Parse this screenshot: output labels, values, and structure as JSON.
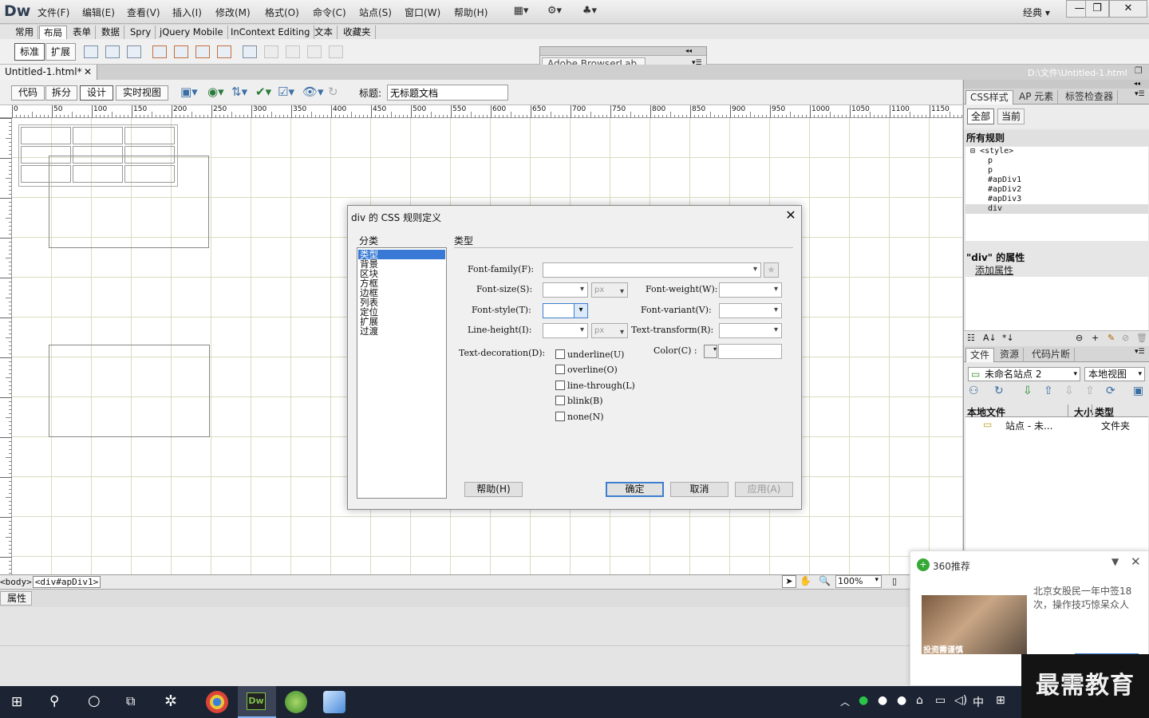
{
  "app": {
    "logo": "Dw",
    "workspace": "经典"
  },
  "menu": [
    "文件(F)",
    "编辑(E)",
    "查看(V)",
    "插入(I)",
    "修改(M)",
    "格式(O)",
    "命令(C)",
    "站点(S)",
    "窗口(W)",
    "帮助(H)"
  ],
  "insert_tabs": [
    "常用",
    "布局",
    "表单",
    "数据",
    "Spry",
    "jQuery Mobile",
    "InContext Editing",
    "文本",
    "收藏夹"
  ],
  "layout_buttons": {
    "standard": "标准",
    "expanded": "扩展"
  },
  "browserlab": {
    "title": "Adobe BrowserLab"
  },
  "document": {
    "tab": "Untitled-1.html*",
    "path": "D:\\文件\\Untitled-1.html"
  },
  "view_buttons": {
    "code": "代码",
    "split": "拆分",
    "design": "设计",
    "live": "实时视图"
  },
  "title_field": {
    "label": "标题:",
    "value": "无标题文档"
  },
  "ruler_marks": [
    "0",
    "50",
    "100",
    "150",
    "200",
    "250",
    "300",
    "350",
    "400",
    "450",
    "500",
    "550",
    "600",
    "650",
    "700",
    "750",
    "800",
    "850",
    "900",
    "950",
    "1000",
    "1050",
    "1100",
    "1150"
  ],
  "status": {
    "tag_body": "<body>",
    "tag_div": "<div#apDiv1>",
    "zoom": "100%"
  },
  "properties": {
    "tab": "属性"
  },
  "css_panel": {
    "tabs": [
      "CSS样式",
      "AP 元素",
      "标签检查器"
    ],
    "mode_all": "全部",
    "mode_current": "当前",
    "all_rules": "所有规则",
    "rules": [
      "<style>",
      "p",
      "p",
      "#apDiv1",
      "#apDiv2",
      "#apDiv3",
      "div"
    ],
    "props_title": "\"div\" 的属性",
    "add_property": "添加属性"
  },
  "files_panel": {
    "tabs": [
      "文件",
      "资源",
      "代码片断"
    ],
    "site": "未命名站点 2",
    "view": "本地视图",
    "cols": [
      "本地文件",
      "大小",
      "类型"
    ],
    "row": {
      "name": "站点 - 未...",
      "type": "文件夹"
    }
  },
  "dialog": {
    "title": "div 的 CSS 规则定义",
    "category_label": "分类",
    "categories": [
      "类型",
      "背景",
      "区块",
      "方框",
      "边框",
      "列表",
      "定位",
      "扩展",
      "过渡"
    ],
    "section": "类型",
    "labels": {
      "font_family": "Font-family(F):",
      "font_size": "Font-size(S):",
      "font_weight": "Font-weight(W):",
      "font_style": "Font-style(T):",
      "font_variant": "Font-variant(V):",
      "line_height": "Line-height(I):",
      "text_transform": "Text-transform(R):",
      "text_decoration": "Text-decoration(D):",
      "color": "Color(C) :"
    },
    "unit": "px",
    "decorations": [
      "underline(U)",
      "overline(O)",
      "line-through(L)",
      "blink(B)",
      "none(N)"
    ],
    "buttons": {
      "help": "帮助(H)",
      "ok": "确定",
      "cancel": "取消",
      "apply": "应用(A)"
    }
  },
  "popup": {
    "title": "360推荐",
    "text": "北京女股民一年中签18次，操作技巧惊呆众人",
    "image_caption": "投资需谨慎"
  },
  "tray": {
    "ime": "中"
  },
  "watermark": "最需教育"
}
